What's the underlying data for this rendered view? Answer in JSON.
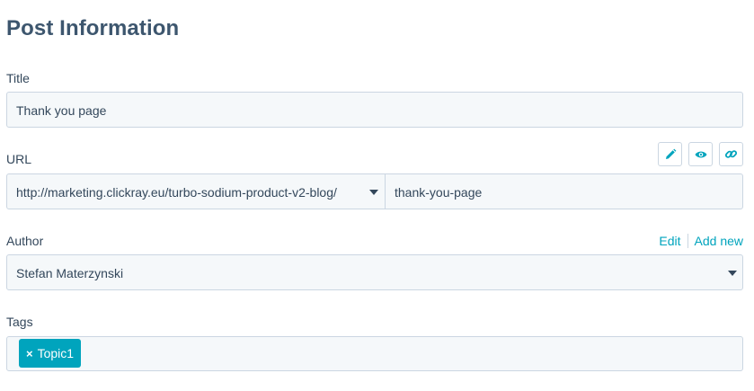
{
  "page_title": "Post Information",
  "title_field": {
    "label": "Title",
    "value": "Thank you page"
  },
  "url_field": {
    "label": "URL",
    "domain_value": "http://marketing.clickray.eu/turbo-sodium-product-v2-blog/",
    "slug_value": "thank-you-page",
    "icons": [
      "pencil-icon",
      "eye-icon",
      "link-icon"
    ]
  },
  "author_field": {
    "label": "Author",
    "value": "Stefan Materzynski",
    "edit_label": "Edit",
    "add_new_label": "Add new"
  },
  "tags_field": {
    "label": "Tags",
    "tags": [
      {
        "label": "Topic1",
        "remove_icon": "×"
      }
    ]
  },
  "colors": {
    "accent": "#00a4bd",
    "text": "#33475b",
    "field_bg": "#f5f8fa",
    "border": "#cbd6e2"
  }
}
